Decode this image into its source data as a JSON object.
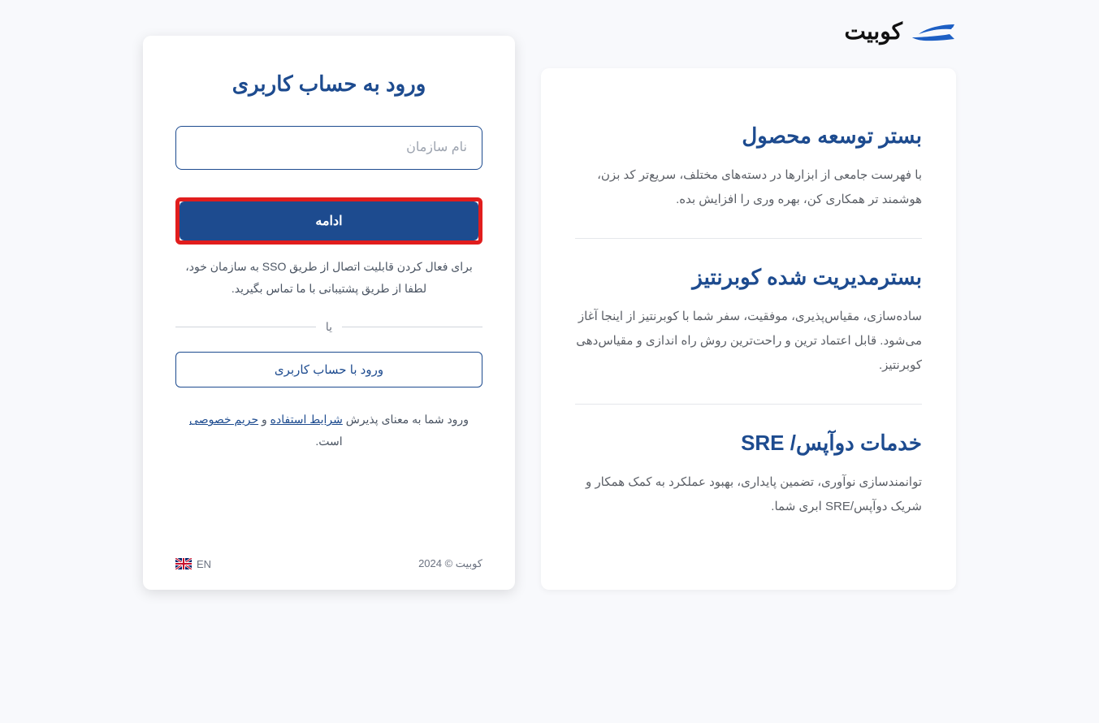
{
  "brand": {
    "name": "کوبیت"
  },
  "info": {
    "section1": {
      "title": "بستر توسعه محصول",
      "desc": "با فهرست جامعی از ابزارها در دسته‌های مختلف، سریع‌تر کد بزن، هوشمند تر همکاری کن، بهره وری را افزایش بده."
    },
    "section2": {
      "title": "بسترمدیریت شده کوبرنتیز",
      "desc": "ساده‌سازی، مقیاس‌پذیری، موفقیت، سفر شما با کوبرنتیز از اینجا آغاز می‌شود. قابل اعتماد ترین و راحت‌ترین روش راه اندازی و مقیاس‌دهی کوبرنتیز."
    },
    "section3": {
      "title": "خدمات دوآپس/ SRE",
      "desc": "توانمندسازی نوآوری، تضمین پایداری، بهبود عملکرد به کمک همکار و شریک دوآپس/SRE ابری شما."
    }
  },
  "login": {
    "title": "ورود به حساب کاربری",
    "org_placeholder": "نام سازمان",
    "continue_label": "ادامه",
    "sso_note": "برای فعال کردن قابلیت اتصال از طریق SSO به سازمان خود، لطفا از طریق پشتیبانی با ما تماس بگیرید.",
    "divider_label": "یا",
    "alt_login_label": "ورود با حساب کاربری",
    "terms_prefix": "ورود شما به معنای پذیرش ",
    "terms_link1": "شرایط استفاده",
    "terms_and": " و ",
    "terms_link2": "حریم خصوصی",
    "terms_suffix": " است."
  },
  "footer": {
    "copyright": "کوبیت © 2024",
    "lang_label": "EN"
  }
}
